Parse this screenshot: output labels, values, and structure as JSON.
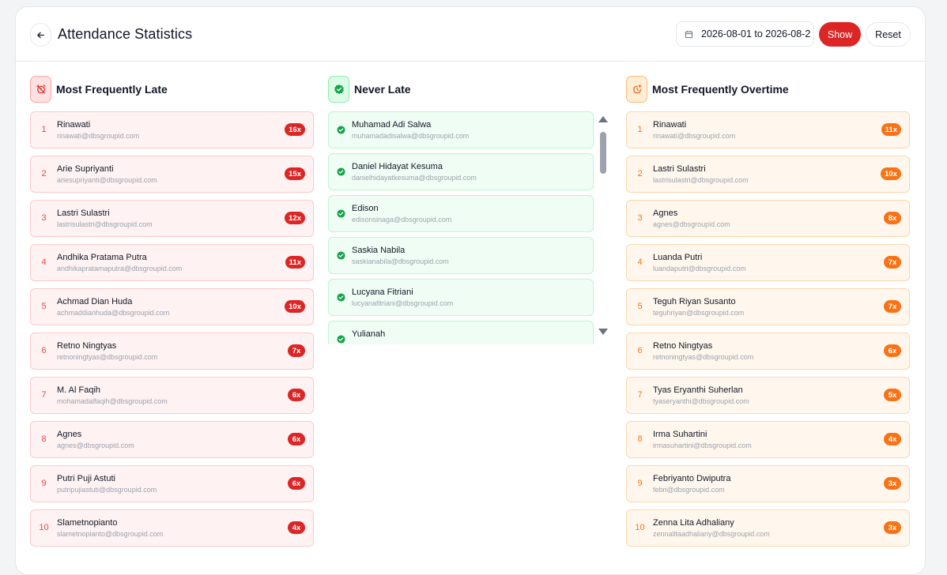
{
  "header": {
    "title": "Attendance Statistics",
    "date_range": "2026-08-01 to 2026-08-2",
    "show_label": "Show",
    "reset_label": "Reset"
  },
  "late": {
    "title": "Most Frequently Late",
    "items": [
      {
        "rank": "1",
        "name": "Rinawati",
        "email": "rinawati@dbsgroupid.com",
        "count": "16x"
      },
      {
        "rank": "2",
        "name": "Arie Supriyanti",
        "email": "ariesupriyanti@dbsgroupid.com",
        "count": "15x"
      },
      {
        "rank": "3",
        "name": "Lastri Sulastri",
        "email": "lastrisulastri@dbsgroupid.com",
        "count": "12x"
      },
      {
        "rank": "4",
        "name": "Andhika Pratama Putra",
        "email": "andhikapratamaputra@dbsgroupid.com",
        "count": "11x"
      },
      {
        "rank": "5",
        "name": "Achmad Dian Huda",
        "email": "achmaddianhuda@dbsgroupid.com",
        "count": "10x"
      },
      {
        "rank": "6",
        "name": "Retno Ningtyas",
        "email": "retnoningtyas@dbsgroupid.com",
        "count": "7x"
      },
      {
        "rank": "7",
        "name": "M. Al Faqih",
        "email": "mohamadalfaqih@dbsgroupid.com",
        "count": "6x"
      },
      {
        "rank": "8",
        "name": "Agnes",
        "email": "agnes@dbsgroupid.com",
        "count": "6x"
      },
      {
        "rank": "9",
        "name": "Putri Puji Astuti",
        "email": "putripujiastuti@dbsgroupid.com",
        "count": "6x"
      },
      {
        "rank": "10",
        "name": "Slametnopianto",
        "email": "slametnopianto@dbsgroupid.com",
        "count": "4x"
      }
    ]
  },
  "never": {
    "title": "Never Late",
    "items": [
      {
        "name": "Muhamad Adi Salwa",
        "email": "muhamadadisalwa@dbsgroupid.com"
      },
      {
        "name": "Daniel Hidayat Kesuma",
        "email": "danielhidayatkesuma@dbsgroupid.com"
      },
      {
        "name": "Edison",
        "email": "edisonsinaga@dbsgroupid.com"
      },
      {
        "name": "Saskia Nabila",
        "email": "saskianabila@dbsgroupid.com"
      },
      {
        "name": "Lucyana Fitriani",
        "email": "lucyanafitriani@dbsgroupid.com"
      },
      {
        "name": "Yulianah",
        "email": ""
      }
    ]
  },
  "overtime": {
    "title": "Most Frequently Overtime",
    "items": [
      {
        "rank": "1",
        "name": "Rinawati",
        "email": "rinawati@dbsgroupid.com",
        "count": "11x"
      },
      {
        "rank": "2",
        "name": "Lastri Sulastri",
        "email": "lastrisulastri@dbsgroupid.com",
        "count": "10x"
      },
      {
        "rank": "3",
        "name": "Agnes",
        "email": "agnes@dbsgroupid.com",
        "count": "8x"
      },
      {
        "rank": "4",
        "name": "Luanda Putri",
        "email": "luandaputri@dbsgroupid.com",
        "count": "7x"
      },
      {
        "rank": "5",
        "name": "Teguh Riyan Susanto",
        "email": "teguhriyan@dbsgroupid.com",
        "count": "7x"
      },
      {
        "rank": "6",
        "name": "Retno Ningtyas",
        "email": "retnoningtyas@dbsgroupid.com",
        "count": "6x"
      },
      {
        "rank": "7",
        "name": "Tyas Eryanthi Suherlan",
        "email": "tyaseryanthi@dbsgroupid.com",
        "count": "5x"
      },
      {
        "rank": "8",
        "name": "Irma Suhartini",
        "email": "irmasuhartini@dbsgroupid.com",
        "count": "4x"
      },
      {
        "rank": "9",
        "name": "Febriyanto Dwiputra",
        "email": "febri@dbsgroupid.com",
        "count": "3x"
      },
      {
        "rank": "10",
        "name": "Zenna Lita Adhaliany",
        "email": "zennalitaadhaliany@dbsgroupid.com",
        "count": "3x"
      }
    ]
  },
  "colors": {
    "late_accent": "#dc2626",
    "never_accent": "#16a34a",
    "overtime_accent": "#f97316"
  }
}
